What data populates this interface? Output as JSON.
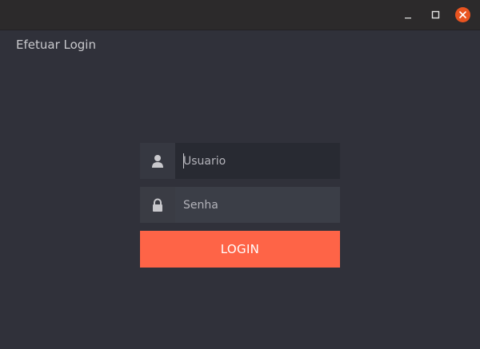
{
  "window": {
    "title_bar_controls": {
      "minimize_icon": "minimize-icon",
      "maximize_icon": "maximize-icon",
      "close_icon": "close-icon",
      "close_color": "#e95420"
    }
  },
  "app": {
    "title": "Efetuar Login"
  },
  "form": {
    "username": {
      "placeholder": "Usuario",
      "value": "",
      "icon": "user-icon"
    },
    "password": {
      "placeholder": "Senha",
      "value": "",
      "icon": "lock-icon"
    },
    "login_label": "LOGIN"
  },
  "colors": {
    "accent": "#fe6447",
    "background": "#30313a"
  }
}
